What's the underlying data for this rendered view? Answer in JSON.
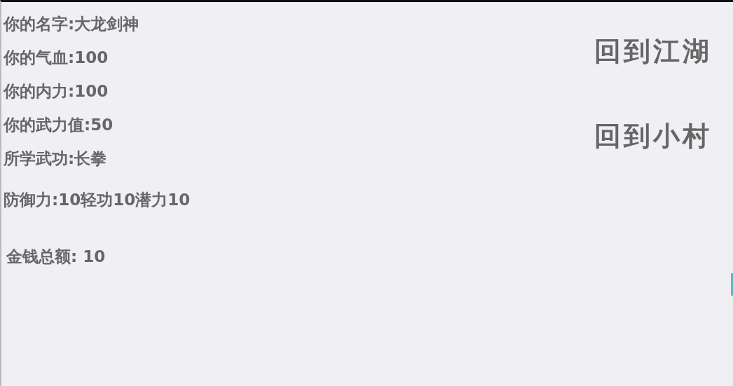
{
  "stats": [
    "你的名字:大龙剑神",
    "你的气血:100",
    "你的内力:100",
    "你的武力值:50",
    "所学武功:长拳"
  ],
  "attributes": "防御力:10轻功10潜力10",
  "money": "金钱总额: 10",
  "actions": [
    "回到江湖",
    "回到小村"
  ]
}
